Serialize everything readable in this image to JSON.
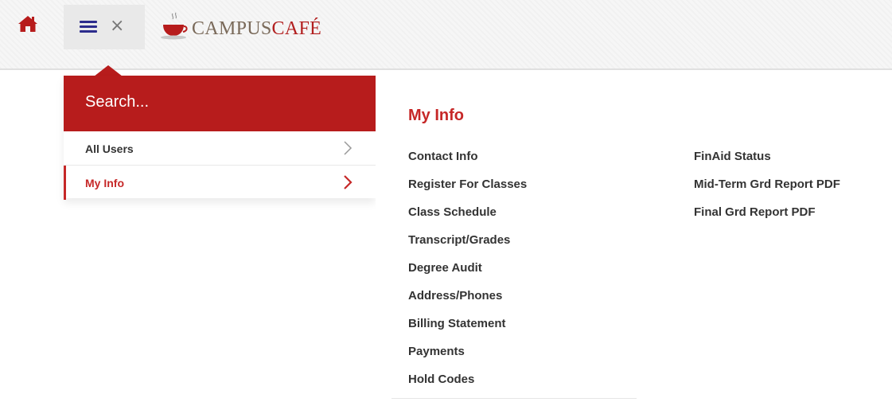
{
  "header": {
    "home_icon": "home-icon",
    "menu_icon": "hamburger-menu-icon",
    "close_glyph": "×",
    "logo": {
      "part1": "CAMPUS",
      "part2": "CAFÉ"
    }
  },
  "sidebar": {
    "search_label": "Search...",
    "items": [
      {
        "label": "All Users",
        "active": false
      },
      {
        "label": "My Info",
        "active": true
      }
    ]
  },
  "main": {
    "title": "My Info",
    "column1": [
      "Contact Info",
      "Register For Classes",
      "Class Schedule",
      "Transcript/Grades",
      "Degree Audit",
      "Address/Phones",
      "Billing Statement",
      "Payments",
      "Hold Codes"
    ],
    "column2": [
      "FinAid Status",
      "Mid-Term Grd Report PDF",
      "Final Grd Report PDF"
    ]
  },
  "colors": {
    "accent": "#b71c1c",
    "active_text": "#c62828",
    "menu_icon": "#2c2c8c"
  }
}
